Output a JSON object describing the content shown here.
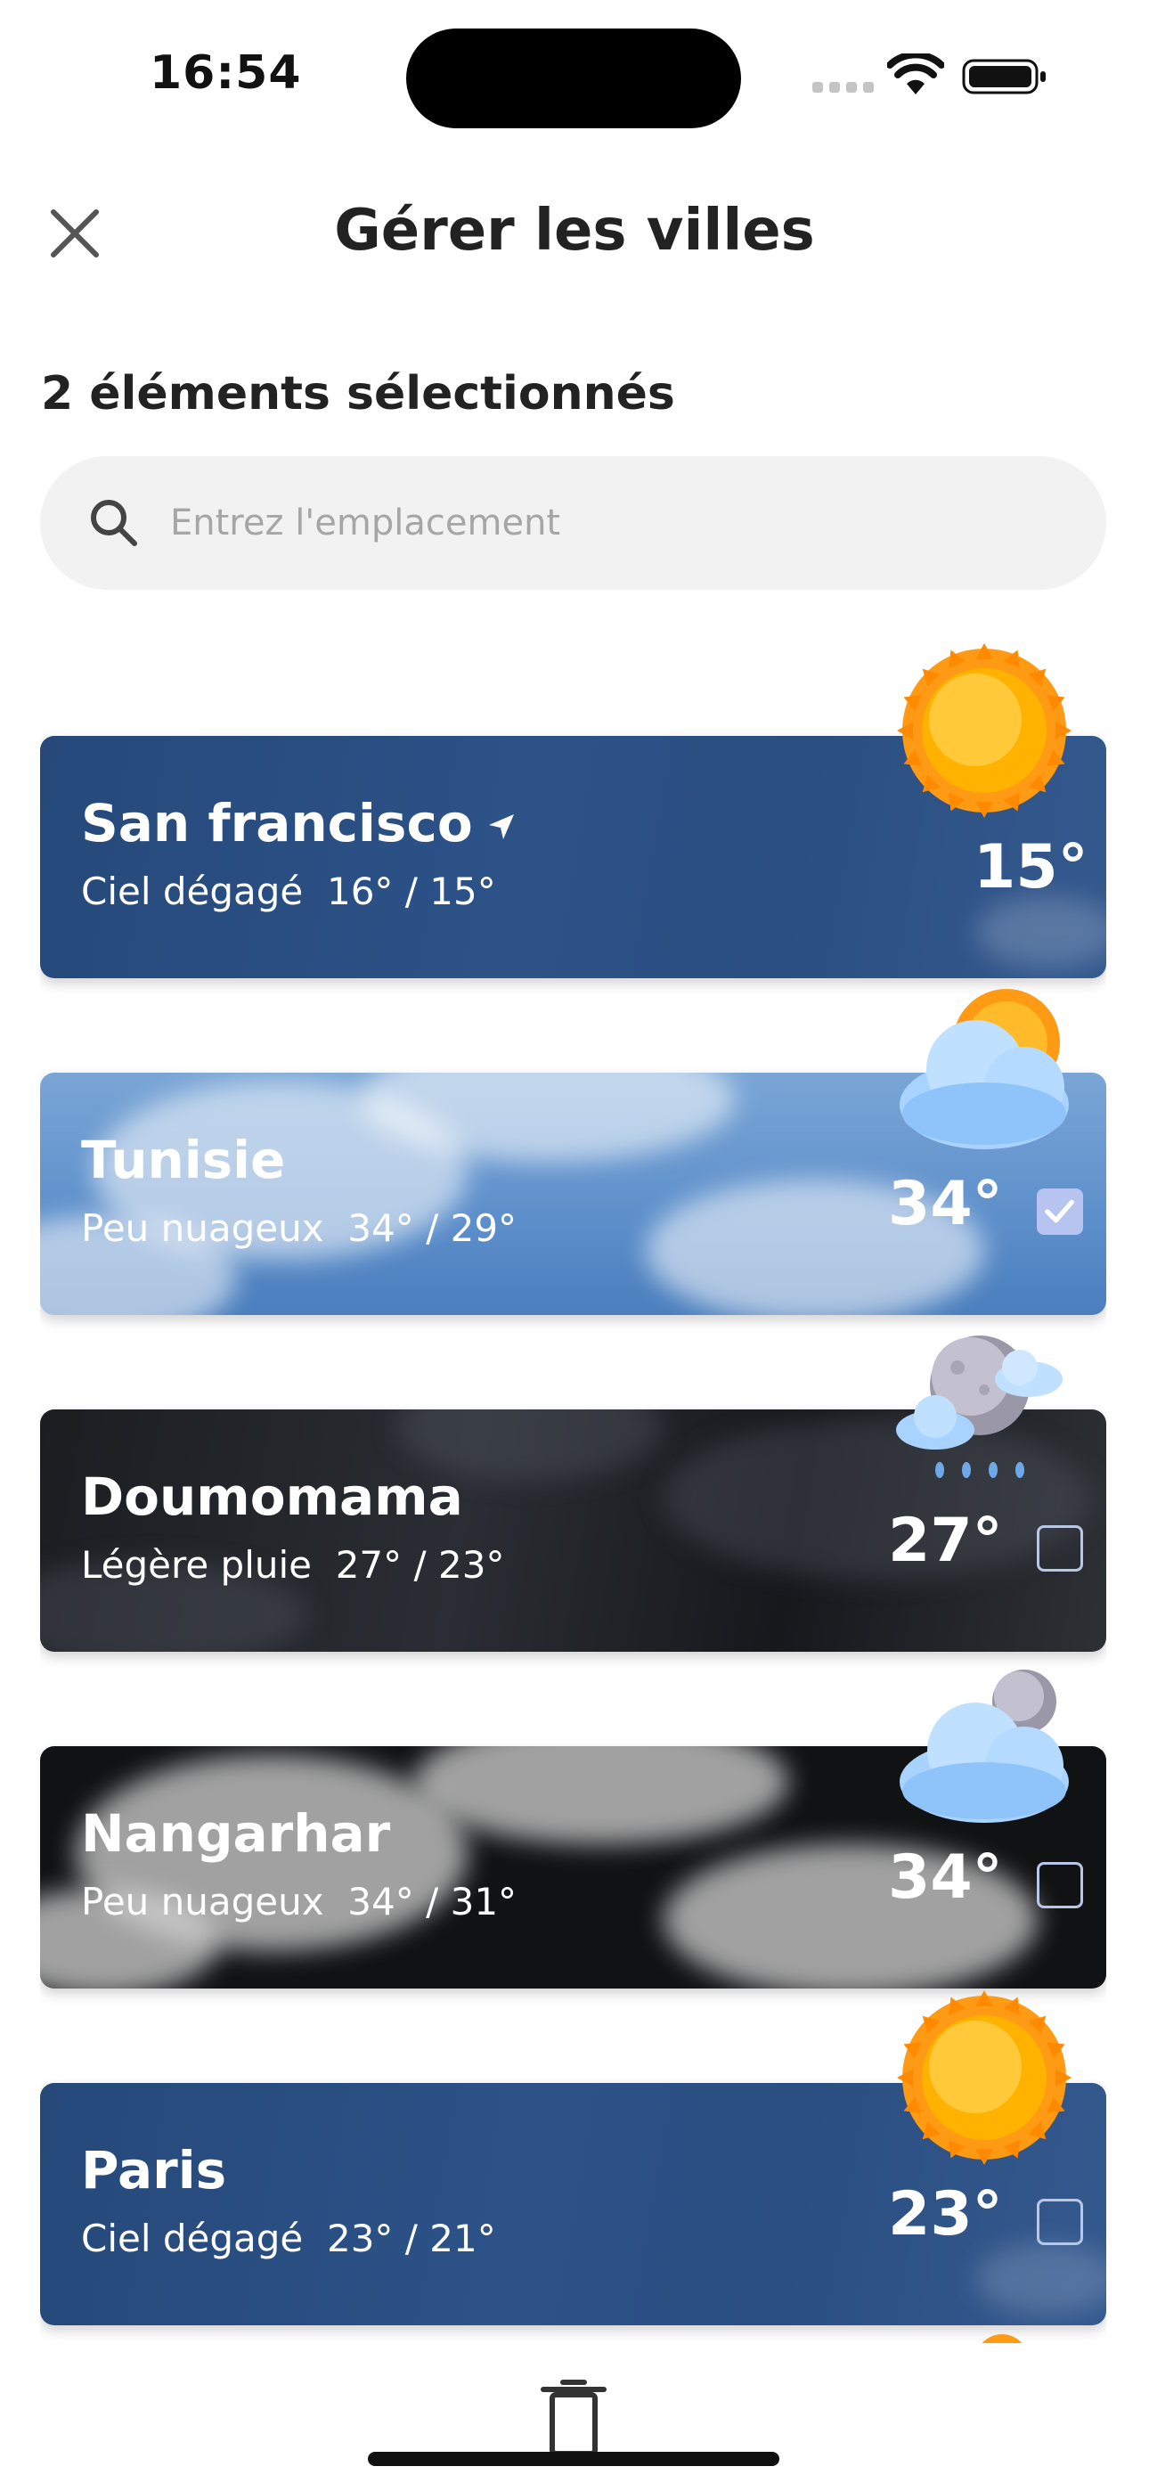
{
  "status_bar": {
    "time": "16:54",
    "icons": [
      "signal-icon",
      "wifi-icon",
      "battery-icon"
    ]
  },
  "header": {
    "title": "Gérer les villes",
    "close_icon": "close-icon"
  },
  "selection": {
    "count_label": "2 éléments sélectionnés"
  },
  "search": {
    "placeholder": "Entrez l'emplacement",
    "value": "",
    "icon": "search-icon"
  },
  "cities": [
    {
      "name": "San francisco",
      "condition": "Ciel dégagé",
      "range": "16° / 15°",
      "temp": "15°",
      "current_location": true,
      "checkbox": "none",
      "icon": "sun-icon"
    },
    {
      "name": "Tunisie",
      "condition": "Peu nuageux",
      "range": "34° / 29°",
      "temp": "34°",
      "current_location": false,
      "checkbox": "checked",
      "icon": "cloud-sun-icon"
    },
    {
      "name": "Doumomama",
      "condition": "Légère pluie",
      "range": "27° / 23°",
      "temp": "27°",
      "current_location": false,
      "checkbox": "unchecked",
      "icon": "moon-rain-icon"
    },
    {
      "name": "Nangarhar",
      "condition": "Peu nuageux",
      "range": "34° / 31°",
      "temp": "34°",
      "current_location": false,
      "checkbox": "unchecked",
      "icon": "cloud-moon-icon"
    },
    {
      "name": "Paris",
      "condition": "Ciel dégagé",
      "range": "23° / 21°",
      "temp": "23°",
      "current_location": false,
      "checkbox": "unchecked",
      "icon": "sun-icon"
    }
  ],
  "bottom_bar": {
    "action_icon": "trash-icon"
  },
  "colors": {
    "clear_card": "#2b4f82",
    "checkbox_checked": "#b7c4f0",
    "sun_core": "#ffb300",
    "sun_rays": "#ff8a00"
  }
}
